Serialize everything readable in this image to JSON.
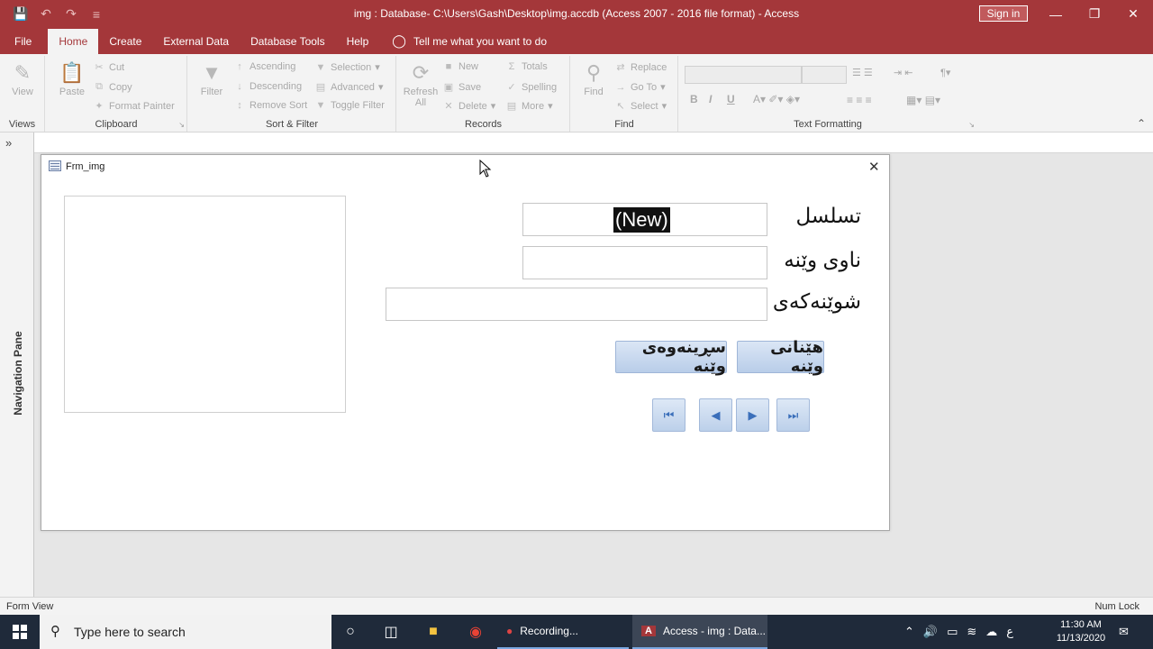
{
  "window": {
    "title": "img : Database- C:\\Users\\Gash\\Desktop\\img.accdb (Access 2007 - 2016 file format)  -  Access",
    "sign_in": "Sign in"
  },
  "ribbon_tabs": [
    "File",
    "Home",
    "Create",
    "External Data",
    "Database Tools",
    "Help"
  ],
  "tell_me": "Tell me what you want to do",
  "ribbon": {
    "views": {
      "label": "Views",
      "view": "View"
    },
    "clipboard": {
      "label": "Clipboard",
      "paste": "Paste",
      "cut": "Cut",
      "copy": "Copy",
      "format_painter": "Format Painter"
    },
    "sort_filter": {
      "label": "Sort & Filter",
      "filter": "Filter",
      "ascending": "Ascending",
      "descending": "Descending",
      "remove_sort": "Remove Sort",
      "selection": "Selection",
      "advanced": "Advanced",
      "toggle_filter": "Toggle Filter"
    },
    "records": {
      "label": "Records",
      "refresh": "Refresh",
      "refresh_all": "All",
      "new": "New",
      "save": "Save",
      "delete": "Delete",
      "totals": "Totals",
      "spelling": "Spelling",
      "more": "More"
    },
    "find": {
      "label": "Find",
      "find": "Find",
      "replace": "Replace",
      "go_to": "Go To",
      "select": "Select"
    },
    "text_formatting": {
      "label": "Text Formatting",
      "bold": "B",
      "italic": "I",
      "underline": "U"
    }
  },
  "nav_pane": {
    "label": "Navigation Pane"
  },
  "form": {
    "title": "Frm_img",
    "fields": {
      "serial": {
        "label": "تسلسل",
        "value": "(New)"
      },
      "image_name": {
        "label": "ناوی وێنە",
        "value": ""
      },
      "location": {
        "label": "شوێنەکەی",
        "value": ""
      }
    },
    "buttons": {
      "get_image": "هێنانی وێنە",
      "delete_image": "سڕینەوەی وێنە"
    }
  },
  "status": {
    "left": "Form View",
    "right": "Num Lock"
  },
  "taskbar": {
    "search_placeholder": "Type here to search",
    "apps": [
      {
        "label": "Recording..."
      },
      {
        "label": "Access - img : Data..."
      }
    ],
    "clock_time": "11:30 AM",
    "clock_date": "11/13/2020",
    "lang": "ع"
  },
  "colors": {
    "title_bar": "#a4373a",
    "taskbar": "#1f2a3a",
    "button_face": "#c9d9ef"
  }
}
